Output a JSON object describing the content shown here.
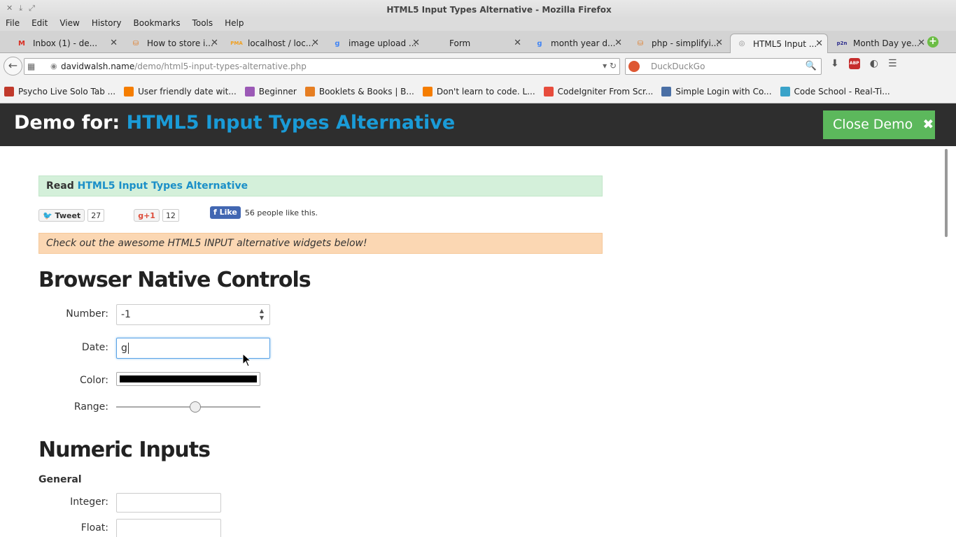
{
  "window": {
    "title": "HTML5 Input Types Alternative - Mozilla Firefox",
    "controls": [
      "✕",
      "⤓",
      "⤢"
    ]
  },
  "menu": [
    "File",
    "Edit",
    "View",
    "History",
    "Bookmarks",
    "Tools",
    "Help"
  ],
  "tabs": [
    {
      "label": "Inbox (1) - de...",
      "icon": "gmail-icon",
      "color": "#d93025",
      "glyph": "M"
    },
    {
      "label": "How to store i...",
      "icon": "stackoverflow-icon",
      "color": "#e07b24",
      "glyph": "⛁"
    },
    {
      "label": "localhost / loc...",
      "icon": "phpmyadmin-icon",
      "color": "#f0a020",
      "glyph": "PMA"
    },
    {
      "label": "image upload ...",
      "icon": "google-icon",
      "color": "#4285f4",
      "glyph": "g"
    },
    {
      "label": "Form",
      "icon": "blank-icon",
      "color": "#ffffff",
      "glyph": ""
    },
    {
      "label": "month year d...",
      "icon": "google-icon",
      "color": "#4285f4",
      "glyph": "g"
    },
    {
      "label": "php - simplifyi...",
      "icon": "stackoverflow-icon",
      "color": "#e07b24",
      "glyph": "⛁"
    },
    {
      "label": "HTML5 Input ...",
      "icon": "davidwalsh-icon",
      "color": "#888888",
      "glyph": "◎",
      "active": true
    },
    {
      "label": "Month Day ye...",
      "icon": "p2n-icon",
      "color": "#2b2b8c",
      "glyph": "p2n"
    }
  ],
  "navbar": {
    "url_domain": "davidwalsh.name",
    "url_path": "/demo/html5-input-types-alternative.php",
    "search_placeholder": "DuckDuckGo"
  },
  "bookmarks": [
    {
      "label": "Psycho Live Solo Tab ...",
      "icon": "guitar-icon",
      "color": "#c0392b"
    },
    {
      "label": "User friendly date wit...",
      "icon": "blogger-icon",
      "color": "#f57d00"
    },
    {
      "label": "Beginner",
      "icon": "beginner-icon",
      "color": "#9b59b6"
    },
    {
      "label": "Booklets & Books | B...",
      "icon": "booklets-icon",
      "color": "#e67e22"
    },
    {
      "label": "Don't learn to code. L...",
      "icon": "blogger-icon",
      "color": "#f57d00"
    },
    {
      "label": "CodeIgniter From Scr...",
      "icon": "tutsplus-icon",
      "color": "#e74c3c"
    },
    {
      "label": "Simple Login with Co...",
      "icon": "page-icon",
      "color": "#4a6fa5"
    },
    {
      "label": "Code School - Real-Ti...",
      "icon": "codeschool-icon",
      "color": "#3aa3c9"
    }
  ],
  "demo": {
    "prefix": "Demo for:",
    "title": "HTML5 Input Types Alternative",
    "close_label": "Close Demo"
  },
  "read": {
    "prefix": "Read",
    "link": "HTML5 Input Types Alternative"
  },
  "social": {
    "tweet_label": "Tweet",
    "tweet_count": "27",
    "gplus_label": "+1",
    "gplus_count": "12",
    "fb_label": "Like",
    "fb_text": "56 people like this."
  },
  "note": "Check out the awesome HTML5 INPUT alternative widgets below!",
  "native": {
    "heading": "Browser Native Controls",
    "number_label": "Number:",
    "number_value": "-1",
    "date_label": "Date:",
    "date_value": "g",
    "color_label": "Color:",
    "color_value": "#000000",
    "range_label": "Range:",
    "range_fraction": 0.55
  },
  "numeric": {
    "heading": "Numeric Inputs",
    "sub": "General",
    "integer_label": "Integer:",
    "float_label": "Float:"
  }
}
